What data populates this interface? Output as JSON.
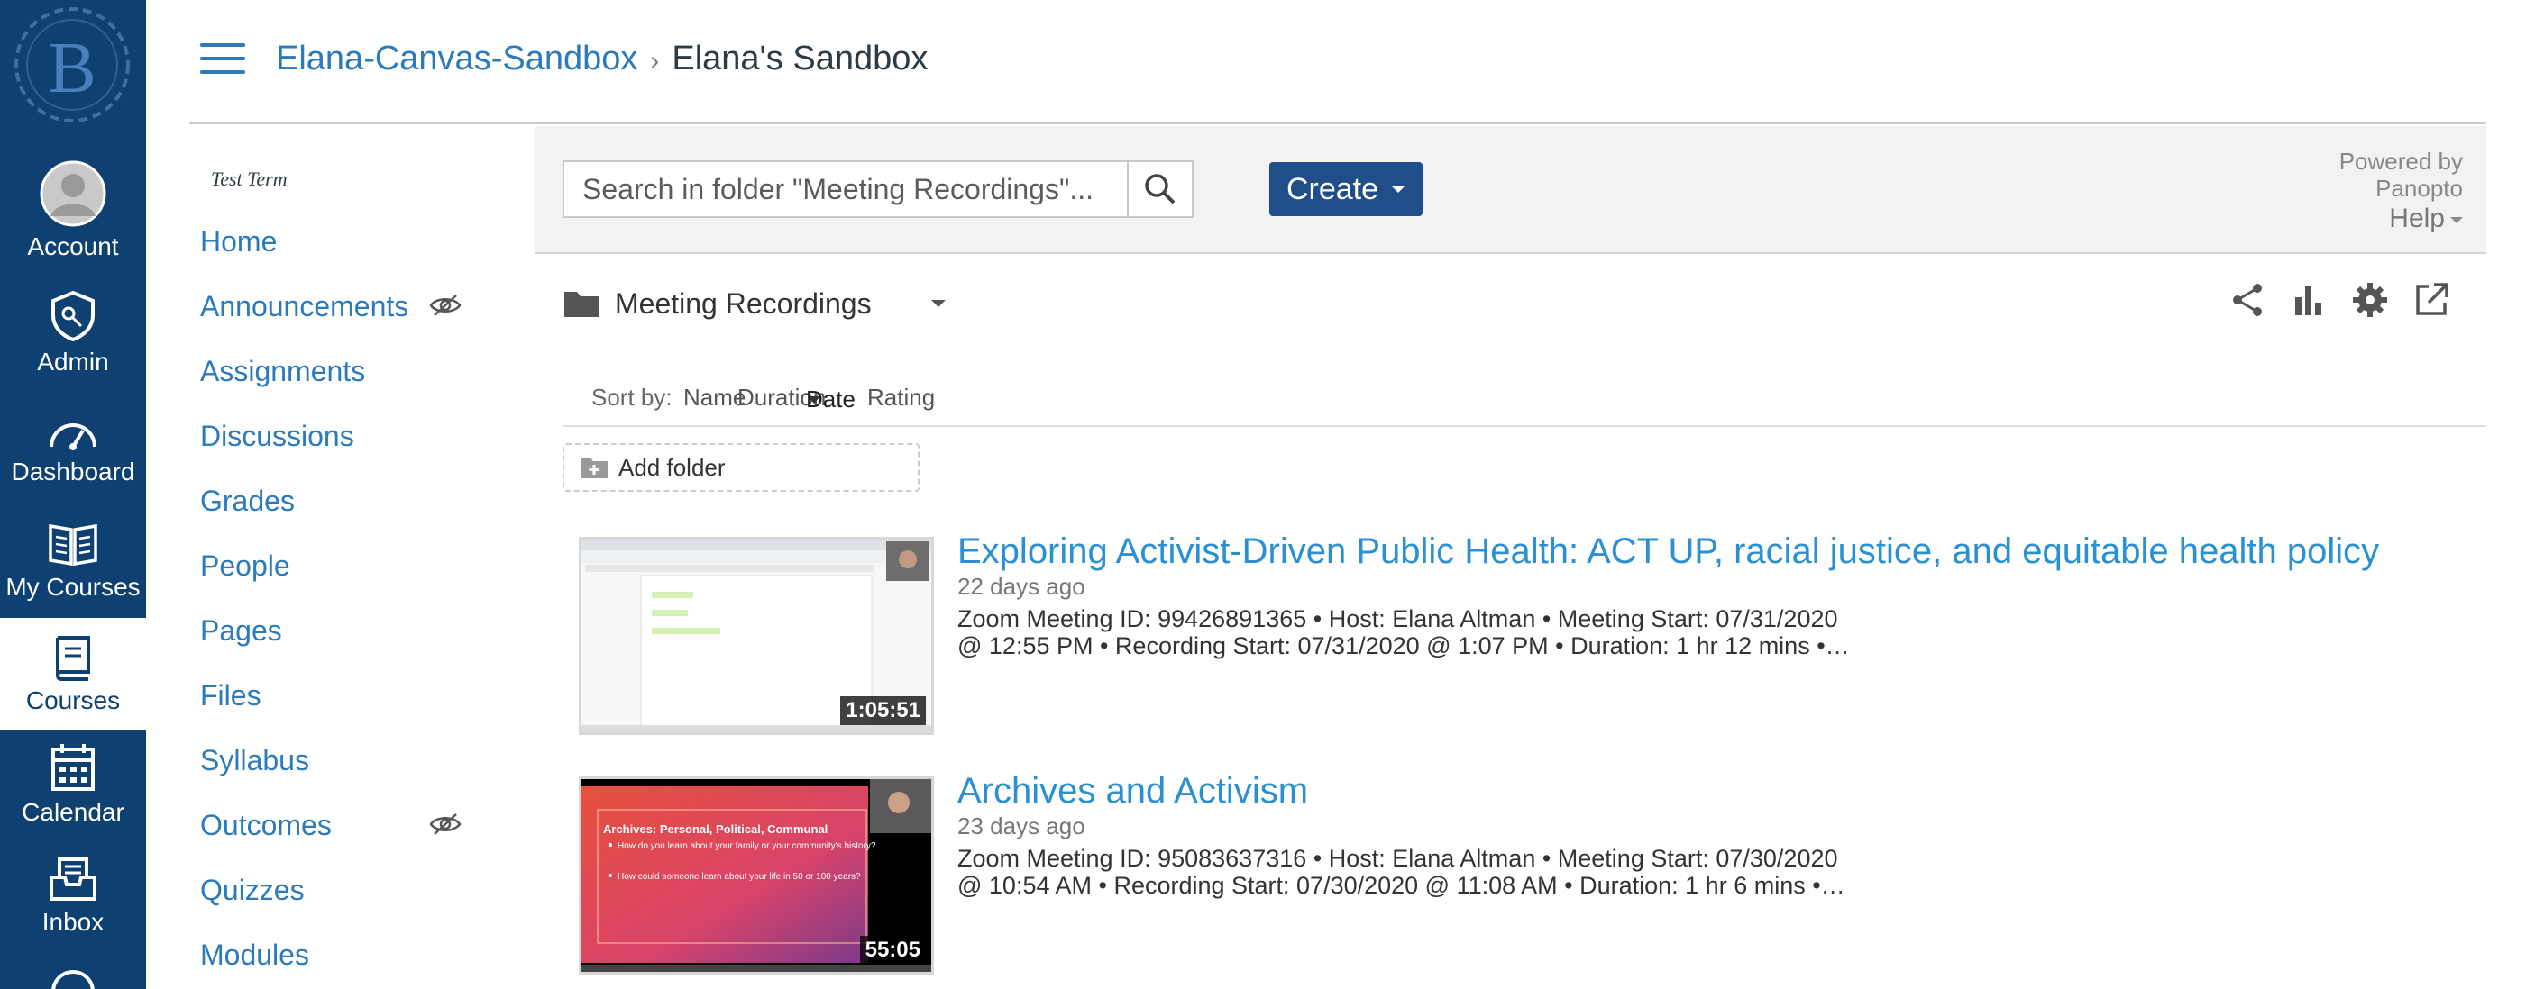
{
  "global_nav": {
    "logo_letter": "B",
    "items": [
      {
        "label": "Account",
        "icon": "account-avatar-icon"
      },
      {
        "label": "Admin",
        "icon": "admin-shield-icon"
      },
      {
        "label": "Dashboard",
        "icon": "dashboard-gauge-icon"
      },
      {
        "label": "My Courses",
        "icon": "my-courses-book-icon"
      },
      {
        "label": "Courses",
        "icon": "courses-book-icon",
        "active": true
      },
      {
        "label": "Calendar",
        "icon": "calendar-icon"
      },
      {
        "label": "Inbox",
        "icon": "inbox-icon"
      }
    ],
    "colors": {
      "background": "#0e4171",
      "active_background": "#ffffff"
    }
  },
  "header": {
    "breadcrumb": {
      "course": "Elana-Canvas-Sandbox",
      "separator": "›",
      "current": "Elana's Sandbox"
    }
  },
  "course_nav": {
    "term": "Test Term",
    "items": [
      {
        "label": "Home"
      },
      {
        "label": "Announcements",
        "hidden_icon": true
      },
      {
        "label": "Assignments"
      },
      {
        "label": "Discussions"
      },
      {
        "label": "Grades"
      },
      {
        "label": "People"
      },
      {
        "label": "Pages"
      },
      {
        "label": "Files"
      },
      {
        "label": "Syllabus"
      },
      {
        "label": "Outcomes",
        "hidden_icon": true
      },
      {
        "label": "Quizzes"
      },
      {
        "label": "Modules"
      }
    ]
  },
  "panopto": {
    "search": {
      "placeholder": "Search in folder \"Meeting Recordings\"..."
    },
    "create_label": "Create",
    "powered_by": "Powered by",
    "powered_by_brand": "Panopto",
    "help_label": "Help",
    "folder": {
      "name": "Meeting Recordings"
    },
    "tool_icons": [
      "share-icon",
      "stats-icon",
      "settings-icon",
      "open-external-icon"
    ],
    "sort": {
      "label": "Sort by:",
      "name": "Name",
      "duration": "Duration",
      "date": "Date",
      "rating": "Rating",
      "active": "Date"
    },
    "add_folder_label": "Add folder",
    "sessions": [
      {
        "title": "Exploring Activist-Driven Public Health: ACT UP, racial justice, and equitable health policy",
        "age": "22 days ago",
        "description_line1": "Zoom Meeting ID: 99426891365   • Host: Elana Altman   • Meeting Start: 07/31/2020",
        "description_line2": "@ 12:55 PM   • Recording Start: 07/31/2020 @ 1:07 PM   • Duration: 1 hr 12 mins   •…",
        "duration": "1:05:51"
      },
      {
        "title": "Archives and Activism",
        "age": "23 days ago",
        "description_line1": "Zoom Meeting ID: 95083637316   • Host: Elana Altman   • Meeting Start: 07/30/2020",
        "description_line2": "@ 10:54 AM   • Recording Start: 07/30/2020 @ 11:08 AM   • Duration: 1 hr 6 mins   •…",
        "duration": "55:05",
        "slide_title": "Archives: Personal, Political, Communal",
        "slide_bullet1": "How do you learn about your family or your community's history?",
        "slide_bullet2": "How could someone learn about your life in 50 or 100 years?"
      }
    ],
    "colors": {
      "link": "#2b8fd4",
      "create_button": "#1f4e89",
      "toolbar_bg": "#f2f2f2"
    }
  }
}
